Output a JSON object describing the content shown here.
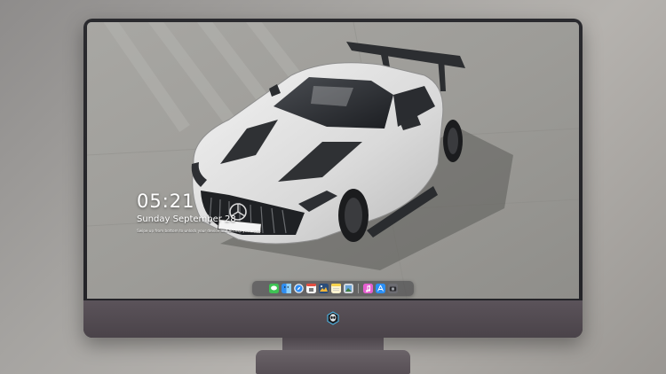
{
  "lock_screen": {
    "time": "05:21",
    "date": "Sunday September 28",
    "hint": "Swipe up from bottom to unlock your device and access your apps"
  },
  "dock": {
    "apps": [
      {
        "icon": "messages-icon",
        "color": "#3ec254"
      },
      {
        "icon": "finder-icon",
        "color": "#2f8df0"
      },
      {
        "icon": "safari-icon",
        "color": "#e9eef5"
      },
      {
        "icon": "calendar-icon",
        "color": "#f5f5f5"
      },
      {
        "icon": "photos-icon",
        "color": "#f1b63a"
      },
      {
        "icon": "notes-icon",
        "color": "#f7d24c"
      },
      {
        "icon": "preview-icon",
        "color": "#cfd6de"
      },
      {
        "icon": "itunes-icon",
        "color": "#e65fd0"
      },
      {
        "icon": "app-store-icon",
        "color": "#2b8ff5"
      },
      {
        "icon": "camera-icon",
        "color": "#6c6c72"
      }
    ]
  },
  "colors": {
    "bezel": "#2a2a2e",
    "chin": "#524b51",
    "accent": "#4fc3f7"
  }
}
